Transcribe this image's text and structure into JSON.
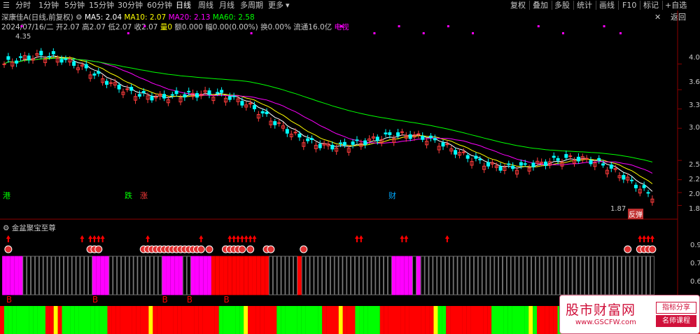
{
  "toolbar": {
    "periods": [
      "分时",
      "1分钟",
      "5分钟",
      "15分钟",
      "30分钟",
      "60分钟",
      "日线",
      "周线",
      "月线",
      "多周期",
      "更多"
    ],
    "active_period": "日线",
    "right_buttons": [
      "复权",
      "叠加",
      "多股",
      "统计",
      "画线",
      "F10",
      "标记",
      "+自选",
      "返回"
    ]
  },
  "stock": {
    "name": "深康佳A",
    "mode": "(日线,前复权)",
    "ma5_label": "MA5: 2.04",
    "ma10_label": "MA10: 2.07",
    "ma20_label": "MA20: 2.13",
    "ma60_label": "MA60: 2.58"
  },
  "quote": {
    "date": "2024/07/16/二",
    "open": "开2.07",
    "high": "高2.07",
    "low": "低2.07",
    "close": "收2.07",
    "vol": "量0",
    "amount": "额0.000",
    "amp": "幅0.00(0.00%)",
    "turnover": "换0.00%",
    "float": "流通16.0亿",
    "tag": "电视"
  },
  "price_axis": {
    "ticks": [
      "4.0",
      "3.6",
      "3.3",
      "3.0",
      "2.5",
      "2.2",
      "2.0",
      "1.8"
    ],
    "high_mark": "4.35",
    "low_mark": "1.87"
  },
  "event_markers": {
    "hk": "港",
    "fall": "跌",
    "rise": "涨",
    "finance": "财",
    "rebound": "反弹"
  },
  "indicator": {
    "title": "金盆聚宝至尊",
    "axis_ticks": [
      "0.9",
      "0.7",
      "0.6"
    ],
    "buy_label": "B"
  },
  "watermark": {
    "main": "股市财富网",
    "url": "www.GSCFW.com",
    "tag1": "指标分享",
    "tag2": "名师课程"
  },
  "colors": {
    "up": "#ff3c3c",
    "down": "#00ffff",
    "ma5": "#ffffff",
    "ma10": "#ffff00",
    "ma20": "#ff00ff",
    "ma60": "#00ff00",
    "magenta_bar": "#ff00ff",
    "red_bar": "#ff0000",
    "green_bar": "#00ff00",
    "yellow_bar": "#ffff00"
  },
  "chart_data": {
    "type": "candlestick",
    "ylim": [
      1.75,
      4.45
    ],
    "series": [
      {
        "name": "MA5"
      },
      {
        "name": "MA10"
      },
      {
        "name": "MA20"
      },
      {
        "name": "MA60"
      }
    ]
  }
}
